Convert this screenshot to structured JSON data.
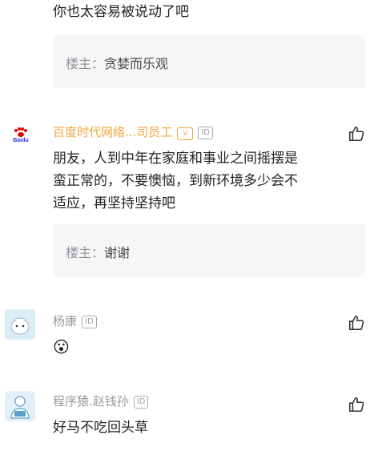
{
  "comment0": {
    "text": "你也太容易被说动了吧"
  },
  "reply0": {
    "owner_label": "楼主：",
    "text": "贪婪而乐观"
  },
  "comment1": {
    "username": "百度时代网络...司员工",
    "id_label": "ID",
    "verify_label": "V",
    "avatar_text": "Baidu",
    "text_lines": [
      "朋友，人到中年在家庭和事业之间摇摆是",
      "蛮正常的，不要懊恼，到新环境多少会不",
      "适应，再坚持坚持吧"
    ]
  },
  "reply1": {
    "owner_label": "楼主：",
    "text": "谢谢"
  },
  "comment2": {
    "username": "杨康",
    "id_label": "ID",
    "text": "😮"
  },
  "comment3": {
    "username": "程序猿.赵钱孙",
    "id_label": "ID",
    "text": "好马不吃回头草"
  },
  "colors": {
    "accent_gold": "#f4a43a",
    "reply_bg": "#f6f6f7"
  }
}
